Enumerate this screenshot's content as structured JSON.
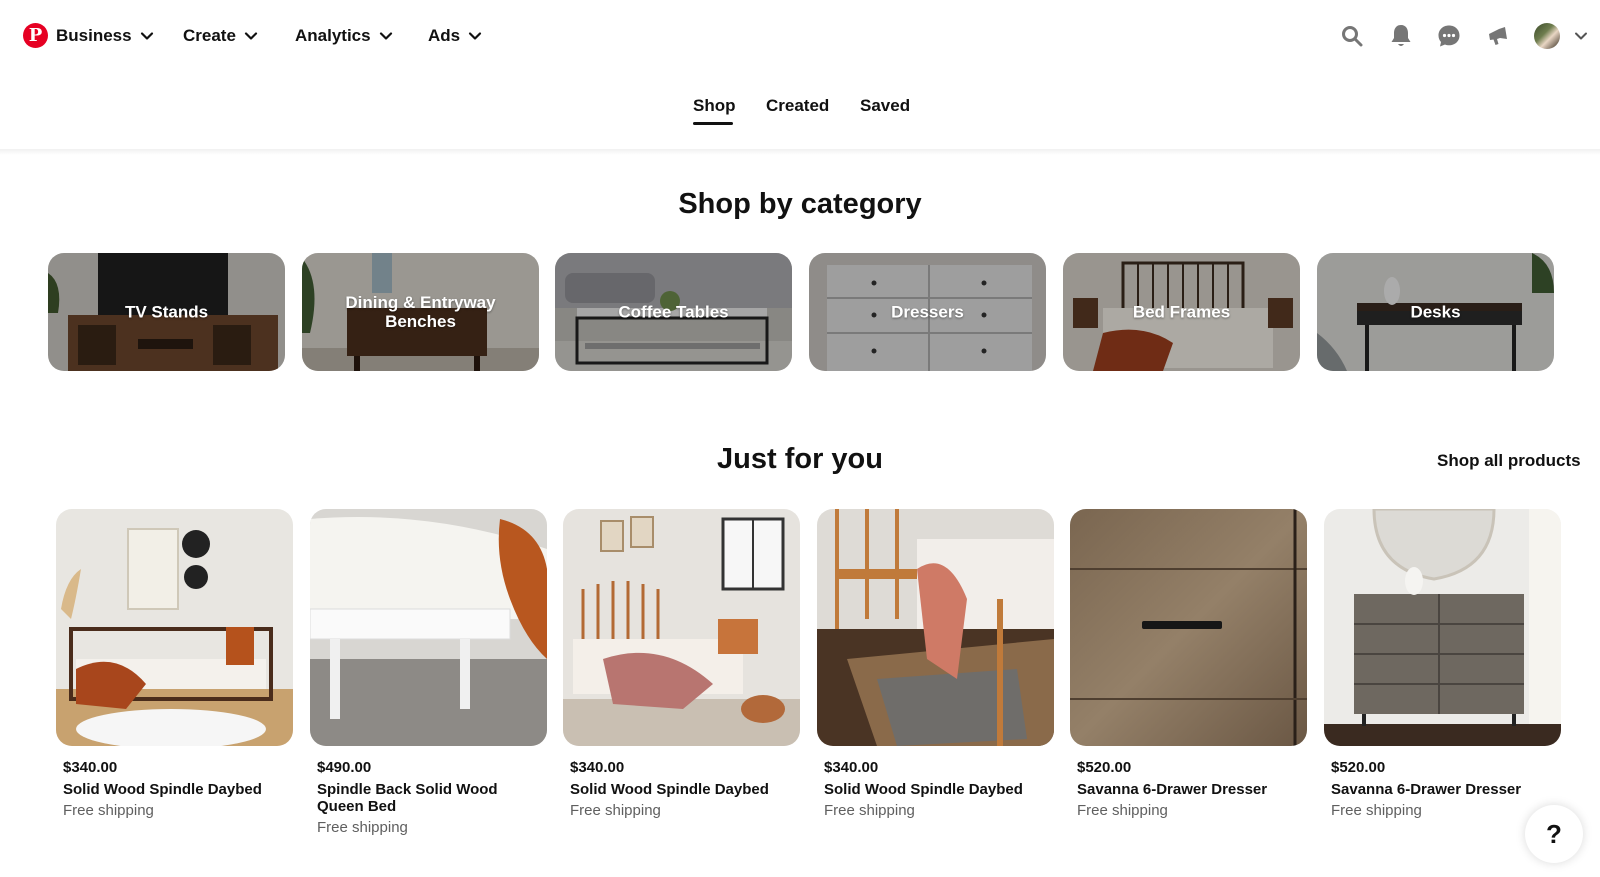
{
  "nav": {
    "logo_glyph": "P",
    "menus": [
      "Business",
      "Create",
      "Analytics",
      "Ads"
    ]
  },
  "tabs": [
    "Shop",
    "Created",
    "Saved"
  ],
  "shop_by_category": {
    "title": "Shop by category",
    "categories": [
      "TV Stands",
      "Dining & Entryway Benches",
      "Coffee Tables",
      "Dressers",
      "Bed Frames",
      "Desks"
    ]
  },
  "just_for_you": {
    "title": "Just for you",
    "shop_all": "Shop all products",
    "products": [
      {
        "price": "$340.00",
        "name": "Solid Wood Spindle Daybed",
        "shipping": "Free shipping"
      },
      {
        "price": "$490.00",
        "name": "Spindle Back Solid Wood Queen Bed",
        "shipping": "Free shipping"
      },
      {
        "price": "$340.00",
        "name": "Solid Wood Spindle Daybed",
        "shipping": "Free shipping"
      },
      {
        "price": "$340.00",
        "name": "Solid Wood Spindle Daybed",
        "shipping": "Free shipping"
      },
      {
        "price": "$520.00",
        "name": "Savanna 6-Drawer Dresser",
        "shipping": "Free shipping"
      },
      {
        "price": "$520.00",
        "name": "Savanna 6-Drawer Dresser",
        "shipping": "Free shipping"
      }
    ]
  },
  "help": {
    "label": "?"
  },
  "colors": {
    "brand": "#e60023",
    "text": "#111111",
    "muted": "#5f5f5f"
  }
}
